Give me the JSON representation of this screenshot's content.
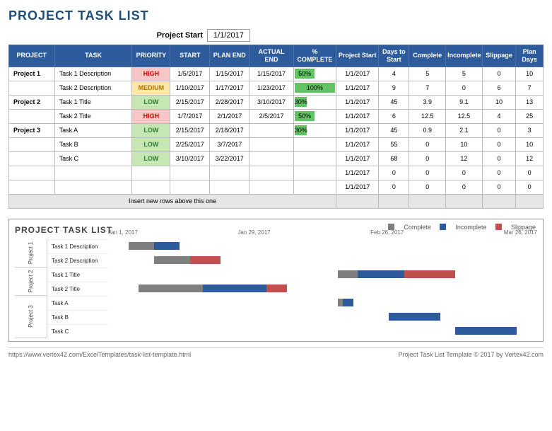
{
  "title": "PROJECT TASK LIST",
  "projectStartLabel": "Project Start",
  "projectStartValue": "1/1/2017",
  "headers": [
    "PROJECT",
    "TASK",
    "PRIORITY",
    "START",
    "PLAN END",
    "ACTUAL END",
    "% COMPLETE",
    "Project Start",
    "Days to Start",
    "Complete",
    "Incomplete",
    "Slippage",
    "Plan Days"
  ],
  "rows": [
    {
      "project": "Project 1",
      "task": "Task 1 Description",
      "priority": "HIGH",
      "start": "1/5/2017",
      "planEnd": "1/15/2017",
      "actualEnd": "1/15/2017",
      "pct": 50,
      "ps": "1/1/2017",
      "dts": "4",
      "comp": "5",
      "inc": "5",
      "slip": "0",
      "pd": "10"
    },
    {
      "project": "",
      "task": "Task 2 Description",
      "priority": "MEDIUM",
      "start": "1/10/2017",
      "planEnd": "1/17/2017",
      "actualEnd": "1/23/2017",
      "pct": 100,
      "ps": "1/1/2017",
      "dts": "9",
      "comp": "7",
      "inc": "0",
      "slip": "6",
      "pd": "7"
    },
    {
      "project": "Project 2",
      "task": "Task 1 Title",
      "priority": "LOW",
      "start": "2/15/2017",
      "planEnd": "2/28/2017",
      "actualEnd": "3/10/2017",
      "pct": 30,
      "ps": "1/1/2017",
      "dts": "45",
      "comp": "3.9",
      "inc": "9.1",
      "slip": "10",
      "pd": "13"
    },
    {
      "project": "",
      "task": "Task 2 Title",
      "priority": "HIGH",
      "start": "1/7/2017",
      "planEnd": "2/1/2017",
      "actualEnd": "2/5/2017",
      "pct": 50,
      "ps": "1/1/2017",
      "dts": "6",
      "comp": "12.5",
      "inc": "12.5",
      "slip": "4",
      "pd": "25"
    },
    {
      "project": "Project 3",
      "task": "Task A",
      "priority": "LOW",
      "start": "2/15/2017",
      "planEnd": "2/18/2017",
      "actualEnd": "",
      "pct": 30,
      "ps": "1/1/2017",
      "dts": "45",
      "comp": "0.9",
      "inc": "2.1",
      "slip": "0",
      "pd": "3"
    },
    {
      "project": "",
      "task": "Task B",
      "priority": "LOW",
      "start": "2/25/2017",
      "planEnd": "3/7/2017",
      "actualEnd": "",
      "pct": null,
      "ps": "1/1/2017",
      "dts": "55",
      "comp": "0",
      "inc": "10",
      "slip": "0",
      "pd": "10"
    },
    {
      "project": "",
      "task": "Task C",
      "priority": "LOW",
      "start": "3/10/2017",
      "planEnd": "3/22/2017",
      "actualEnd": "",
      "pct": null,
      "ps": "1/1/2017",
      "dts": "68",
      "comp": "0",
      "inc": "12",
      "slip": "0",
      "pd": "12"
    },
    {
      "project": "",
      "task": "",
      "priority": "",
      "start": "",
      "planEnd": "",
      "actualEnd": "",
      "pct": null,
      "ps": "1/1/2017",
      "dts": "0",
      "comp": "0",
      "inc": "0",
      "slip": "0",
      "pd": "0"
    },
    {
      "project": "",
      "task": "",
      "priority": "",
      "start": "",
      "planEnd": "",
      "actualEnd": "",
      "pct": null,
      "ps": "1/1/2017",
      "dts": "0",
      "comp": "0",
      "inc": "0",
      "slip": "0",
      "pd": "0"
    }
  ],
  "noteRow": "Insert new rows above this one",
  "chart": {
    "title": "PROJECT TASK LIST",
    "legend": {
      "complete": "Complete",
      "incomplete": "Incomplete",
      "slippage": "Slippage"
    },
    "xTicks": [
      "Jan 1, 2017",
      "Jan 29, 2017",
      "Feb 26, 2017",
      "Mar 26, 2017"
    ],
    "groups": [
      "Project 1",
      "Project 2",
      "Project 3"
    ]
  },
  "chart_data": {
    "type": "bar",
    "orientation": "horizontal-stacked",
    "x_unit": "days since 1/1/2017",
    "categories": [
      "Task 1 Description",
      "Task 2 Description",
      "Task 1 Title",
      "Task 2 Title",
      "Task A",
      "Task B",
      "Task C"
    ],
    "group_map": [
      "Project 1",
      "Project 1",
      "Project 2",
      "Project 2",
      "Project 3",
      "Project 3",
      "Project 3"
    ],
    "offset": [
      4,
      9,
      45,
      6,
      45,
      55,
      68
    ],
    "series": [
      {
        "name": "Complete",
        "color": "#7f7f7f",
        "values": [
          5,
          7,
          3.9,
          12.5,
          0.9,
          0,
          0
        ]
      },
      {
        "name": "Incomplete",
        "color": "#2e5b9b",
        "values": [
          5,
          0,
          9.1,
          12.5,
          2.1,
          10,
          12
        ]
      },
      {
        "name": "Slippage",
        "color": "#c0504d",
        "values": [
          0,
          6,
          10,
          4,
          0,
          0,
          0
        ]
      }
    ],
    "xlim": [
      0,
      84
    ],
    "xTicks": [
      0,
      28,
      56,
      84
    ],
    "xTickLabels": [
      "Jan 1, 2017",
      "Jan 29, 2017",
      "Feb 26, 2017",
      "Mar 26, 2017"
    ]
  },
  "footer": {
    "left": "https://www.vertex42.com/ExcelTemplates/task-list-template.html",
    "right": "Project Task List Template © 2017 by Vertex42.com"
  }
}
